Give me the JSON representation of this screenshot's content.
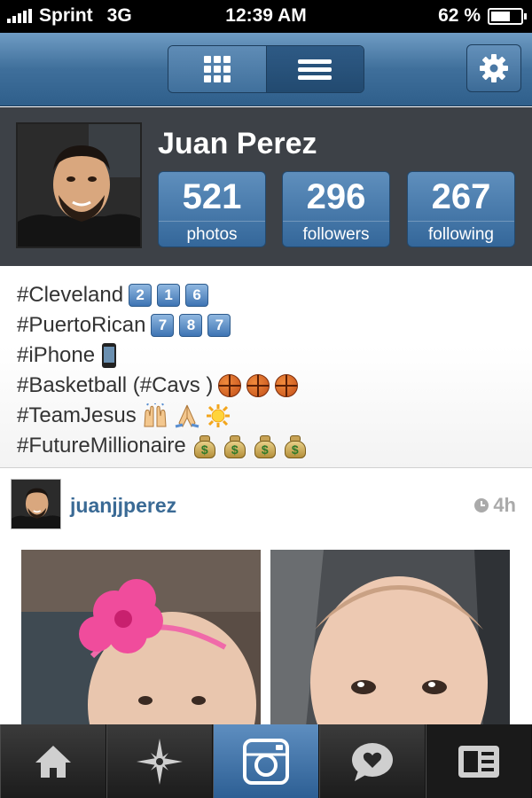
{
  "status_bar": {
    "carrier": "Sprint",
    "network": "3G",
    "time": "12:39 AM",
    "battery_pct": "62 %",
    "battery_level": 0.62
  },
  "nav_bar": {
    "view_grid_icon": "grid-icon",
    "view_list_icon": "list-icon",
    "settings_icon": "gear-icon",
    "accent": "#3f6f9b"
  },
  "profile": {
    "name": "Juan Perez",
    "stats": [
      {
        "value": "521",
        "label": "photos"
      },
      {
        "value": "296",
        "label": "followers"
      },
      {
        "value": "267",
        "label": "following"
      }
    ]
  },
  "bio": {
    "lines": [
      {
        "text": "#Cleveland",
        "keycaps": [
          "2",
          "1",
          "6"
        ]
      },
      {
        "text": "#PuertoRican",
        "keycaps": [
          "7",
          "8",
          "7"
        ]
      },
      {
        "text": "#iPhone",
        "emoji": "mobile-phone-emoji"
      },
      {
        "text": "#Basketball (#Cavs )",
        "emoji": "basketball-emoji"
      },
      {
        "text": "#TeamJesus",
        "emoji": "raised-hands-pray-sun-emoji"
      },
      {
        "text": "#FutureMillionaire",
        "emoji": "money-bag-emoji"
      }
    ]
  },
  "post": {
    "username": "juanjjperez",
    "time_ago": "4h"
  },
  "tab_bar": {
    "tabs": [
      "home-icon",
      "explore-icon",
      "camera-icon",
      "news-icon",
      "profile-icon"
    ]
  }
}
